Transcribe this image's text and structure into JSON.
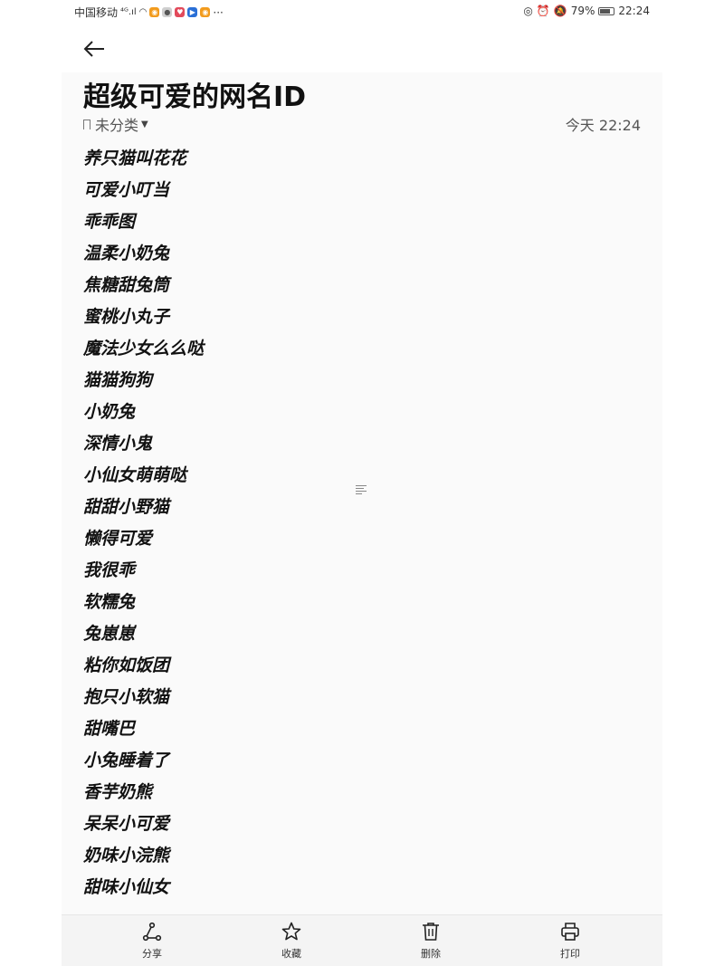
{
  "status_bar": {
    "carrier": "中国移动",
    "signal": "⁴ᴳ.ıl",
    "battery": "79%",
    "battery_level": 0.79,
    "time": "22:24",
    "more": "···"
  },
  "note": {
    "title": "超级可爱的网名ID",
    "category": "未分类",
    "timestamp": "今天 22:24",
    "items": [
      "养只猫叫花花",
      "可爱小叮当",
      "乖乖图",
      "温柔小奶兔",
      "焦糖甜兔筒",
      "蜜桃小丸子",
      "魔法少女么么哒",
      "猫猫狗狗",
      "小奶兔",
      "深情小鬼",
      "小仙女萌萌哒",
      "甜甜小野猫",
      "懒得可爱",
      "我很乖",
      "软糯兔",
      "兔崽崽",
      "粘你如饭团",
      "抱只小软猫",
      "甜嘴巴",
      "小兔睡着了",
      "香芋奶熊",
      "呆呆小可爱",
      "奶味小浣熊",
      "甜味小仙女"
    ]
  },
  "toolbar": {
    "share": "分享",
    "favorite": "收藏",
    "delete": "删除",
    "print": "打印"
  },
  "icons": {
    "back": "arrow-left-icon",
    "share": "share-icon",
    "favorite": "star-icon",
    "delete": "trash-icon",
    "print": "printer-icon"
  }
}
